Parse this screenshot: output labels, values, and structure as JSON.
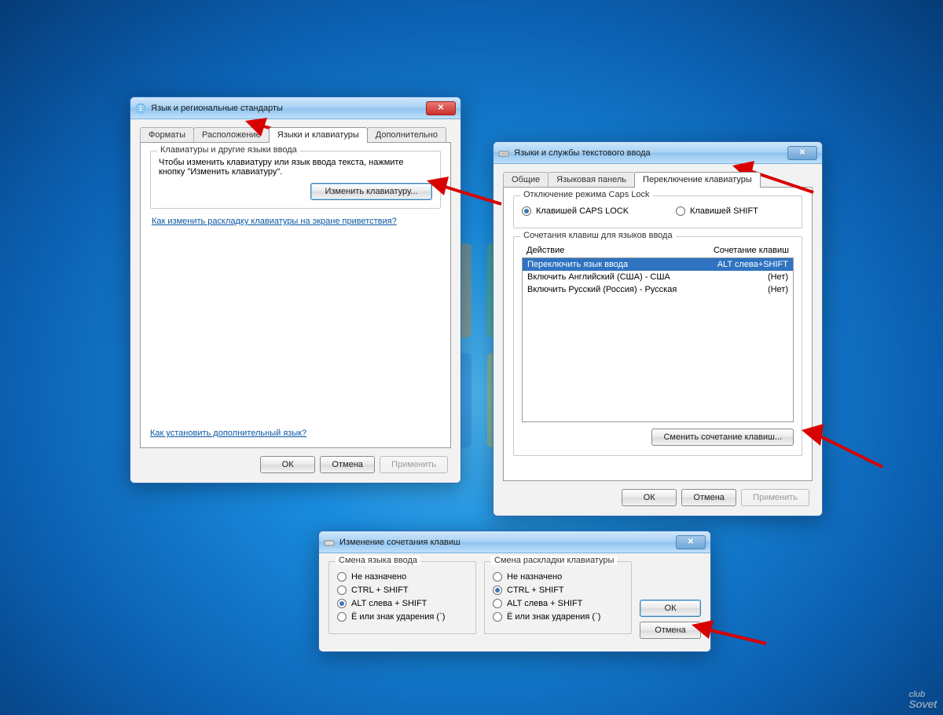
{
  "watermark": {
    "top": "club",
    "bottom": "Sovet"
  },
  "win1": {
    "title": "Язык и региональные стандарты",
    "tabs": [
      "Форматы",
      "Расположение",
      "Языки и клавиатуры",
      "Дополнительно"
    ],
    "group_legend": "Клавиатуры и другие языки ввода",
    "group_text": "Чтобы изменить клавиатуру или язык ввода текста, нажмите кнопку \"Изменить клавиатуру\".",
    "change_kb_btn": "Изменить клавиатуру...",
    "link1": "Как изменить раскладку клавиатуры на экране приветствия?",
    "link2": "Как установить дополнительный язык?",
    "ok": "ОК",
    "cancel": "Отмена",
    "apply": "Применить"
  },
  "win2": {
    "title": "Языки и службы текстового ввода",
    "tabs": [
      "Общие",
      "Языковая панель",
      "Переключение клавиатуры"
    ],
    "caps_legend": "Отключение режима Caps Lock",
    "radio_caps": "Клавишей CAPS LOCK",
    "radio_shift": "Клавишей SHIFT",
    "hot_legend": "Сочетания клавиш для языков ввода",
    "col_action": "Действие",
    "col_combo": "Сочетание клавиш",
    "rows": [
      {
        "action": "Переключить язык ввода",
        "combo": "ALT слева+SHIFT",
        "selected": true
      },
      {
        "action": "Включить Английский (США) - США",
        "combo": "(Нет)",
        "selected": false
      },
      {
        "action": "Включить Русский (Россия) - Русская",
        "combo": "(Нет)",
        "selected": false
      }
    ],
    "change_combo_btn": "Сменить сочетание клавиш...",
    "ok": "ОК",
    "cancel": "Отмена",
    "apply": "Применить"
  },
  "win3": {
    "title": "Изменение сочетания клавиш",
    "left_legend": "Смена языка ввода",
    "right_legend": "Смена раскладки клавиатуры",
    "opts": {
      "none": "Не назначено",
      "ctrl": "CTRL + SHIFT",
      "alt": "ALT слева + SHIFT",
      "e": "Ё или знак ударения (`)"
    },
    "ok": "ОК",
    "cancel": "Отмена"
  }
}
